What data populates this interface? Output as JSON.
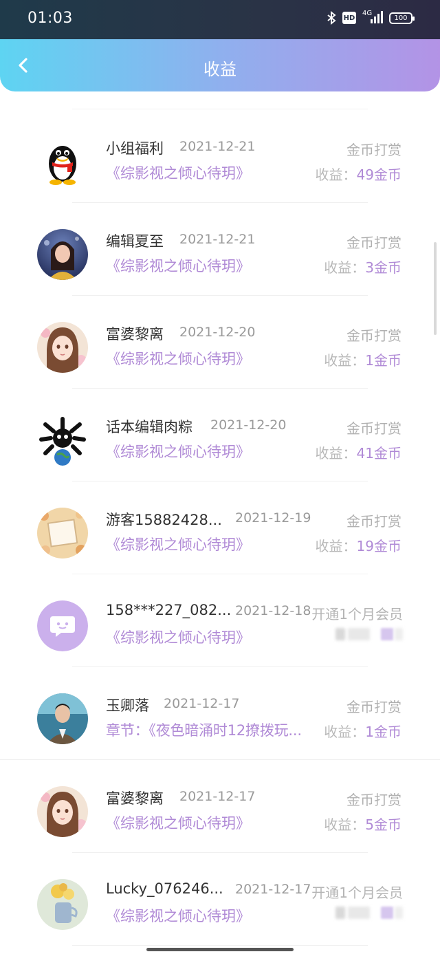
{
  "status_bar": {
    "time": "01:03",
    "hd": "HD",
    "network": "4G",
    "battery": "100"
  },
  "header": {
    "title": "收益",
    "back_icon": "chevron-left-icon"
  },
  "records": [
    {
      "name": "小组福利",
      "date": "2021-12-21",
      "work": "《综影视之倾心待玥》",
      "type": "金币打赏",
      "earn_label": "收益：",
      "earn_value": "49金币",
      "avatar": "penguin"
    },
    {
      "name": "编辑夏至",
      "date": "2021-12-21",
      "work": "《综影视之倾心待玥》",
      "type": "金币打赏",
      "earn_label": "收益：",
      "earn_value": "3金币",
      "avatar": "photo-girl"
    },
    {
      "name": "富婆黎离",
      "date": "2021-12-20",
      "work": "《综影视之倾心待玥》",
      "type": "金币打赏",
      "earn_label": "收益：",
      "earn_value": "1金币",
      "avatar": "anime-girl"
    },
    {
      "name": "话本编辑肉粽",
      "date": "2021-12-20",
      "work": "《综影视之倾心待玥》",
      "type": "金币打赏",
      "earn_label": "收益：",
      "earn_value": "41金币",
      "avatar": "skull-globe"
    },
    {
      "name": "游客15882428...",
      "date": "2021-12-19",
      "work": "《综影视之倾心待玥》",
      "type": "金币打赏",
      "earn_label": "收益：",
      "earn_value": "19金币",
      "avatar": "floral-frame"
    },
    {
      "name": "158***227_082...",
      "date": "2021-12-18",
      "work": "《综影视之倾心待玥》",
      "type": "开通1个月会员",
      "earn_label": "",
      "earn_value": "",
      "avatar": "default-chat"
    },
    {
      "name": "玉卿落",
      "date": "2021-12-17",
      "work": "章节：《夜色暗涌时12撩拨玩...",
      "type": "金币打赏",
      "earn_label": "收益：",
      "earn_value": "1金币",
      "avatar": "photo-man"
    },
    {
      "name": "富婆黎离",
      "date": "2021-12-17",
      "work": "《综影视之倾心待玥》",
      "type": "金币打赏",
      "earn_label": "收益：",
      "earn_value": "5金币",
      "avatar": "anime-girl"
    },
    {
      "name": "Lucky_076246...",
      "date": "2021-12-17",
      "work": "《综影视之倾心待玥》",
      "type": "开通1个月会员",
      "earn_label": "",
      "earn_value": "",
      "avatar": "flower-vase"
    }
  ],
  "colors": {
    "accent_purple": "#b08ad6",
    "header_gradient_start": "#5ed4f2",
    "header_gradient_end": "#b393e6"
  }
}
